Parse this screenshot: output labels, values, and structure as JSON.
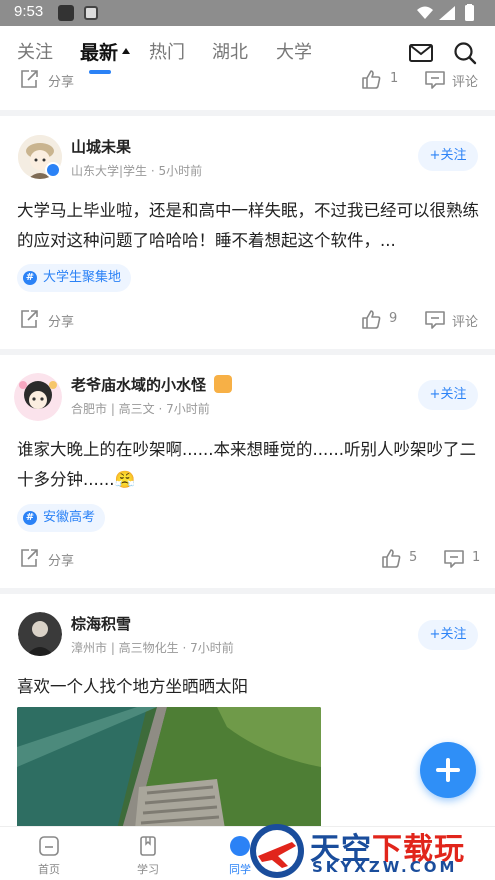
{
  "status_bar": {
    "time": "9:53"
  },
  "tabs": [
    {
      "label": "关注"
    },
    {
      "label": "最新"
    },
    {
      "label": "热门"
    },
    {
      "label": "湖北"
    },
    {
      "label": "大学"
    }
  ],
  "top_actions": {
    "share_label": "分享",
    "like_count": "1",
    "comment_label": "评论"
  },
  "posts": [
    {
      "name": "山城未果",
      "meta": "山东大学|学生 · 5小时前",
      "follow": "+关注",
      "content": "大学马上毕业啦，还是和高中一样失眠，不过我已经可以很熟练的应对这种问题了哈哈哈！睡不着想起这个软件，...",
      "tag": "大学生聚集地",
      "share": "分享",
      "likes": "9",
      "comments": "评论"
    },
    {
      "name": "老爷庙水域的小水怪",
      "meta": "合肥市 | 高三文 · 7小时前",
      "follow": "+关注",
      "content": "谁家大晚上的在吵架啊......本来想睡觉的......听别人吵架吵了二十多分钟......😤",
      "tag": "安徽高考",
      "share": "分享",
      "likes": "5",
      "comments": "1"
    },
    {
      "name": "棕海积雪",
      "meta": "漳州市 | 高三物化生 · 7小时前",
      "follow": "+关注",
      "content": "喜欢一个人找个地方坐晒晒太阳"
    }
  ],
  "bottom_nav": [
    {
      "label": "首页"
    },
    {
      "label": "学习"
    },
    {
      "label": "同学"
    }
  ],
  "watermark": {
    "title_a": "天空",
    "title_b": "下载玩",
    "url": "SKYXZW.COM"
  },
  "colors": {
    "accent": "#2b82f6",
    "fab": "#2f8ff7",
    "status_bar": "#8d8d8d"
  }
}
